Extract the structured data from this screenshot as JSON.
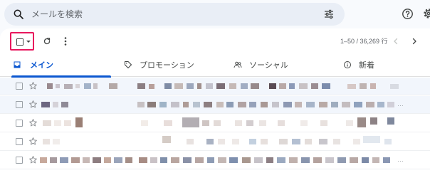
{
  "search": {
    "placeholder": "メールを検索",
    "search_icon": "search-icon",
    "filter_icon": "tune-icon"
  },
  "header": {
    "help_icon": "help-icon",
    "settings_icon": "gear-icon"
  },
  "toolbar": {
    "select_icon": "checkbox-icon",
    "refresh_icon": "refresh-icon",
    "more_icon": "more-vert-icon",
    "pagination": "1–50 / 36,269 行",
    "prev_icon": "chevron-left-icon",
    "next_icon": "chevron-right-icon",
    "highlight_color": "#e8175d"
  },
  "tabs": [
    {
      "label": "メイン",
      "icon": "inbox-icon",
      "active": true
    },
    {
      "label": "プロモーション",
      "icon": "tag-icon",
      "active": false
    },
    {
      "label": "ソーシャル",
      "icon": "people-icon",
      "active": false
    },
    {
      "label": "新着",
      "icon": "info-icon",
      "active": false
    }
  ],
  "colors": {
    "accent": "#0b57d0",
    "read_row_bg": "#f2f6fc",
    "panel_bg": "#ffffff",
    "page_bg": "#f8fafd"
  },
  "rows": [
    {
      "read": true
    },
    {
      "read": true
    },
    {
      "read": false
    },
    {
      "read": false
    },
    {
      "read": false
    }
  ]
}
